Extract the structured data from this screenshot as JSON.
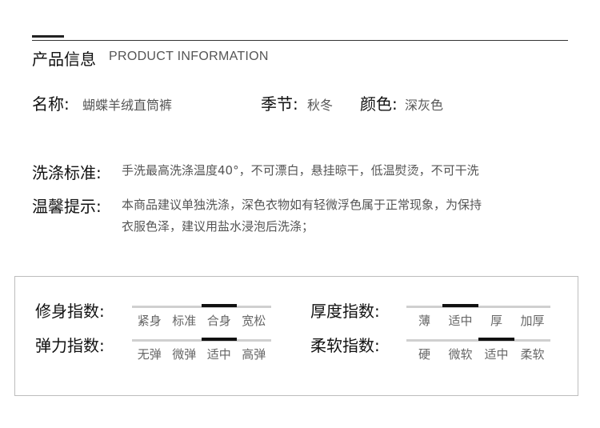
{
  "header": {
    "title_cn": "产品信息",
    "title_en": "PRODUCT INFORMATION"
  },
  "info": {
    "name_label": "名称:",
    "name_value": "蝴蝶羊绒直筒裤",
    "season_label": "季节:",
    "season_value": "秋冬",
    "color_label": "颜色:",
    "color_value": "深灰色"
  },
  "care": {
    "wash_label": "洗涤标准:",
    "wash_value": "手洗最高洗涤温度40°，不可漂白，悬挂晾干，低温熨烫，不可干洗",
    "tips_label": "温馨提示:",
    "tips_line1": "本商品建议单独洗涤，深色衣物如有轻微浮色属于正常现象，为保持",
    "tips_line2": "衣服色泽，建议用盐水浸泡后洗涤；"
  },
  "indices": {
    "fit": {
      "label": "修身指数:",
      "options": [
        "紧身",
        "标准",
        "合身",
        "宽松"
      ],
      "selected": 2
    },
    "thickness": {
      "label": "厚度指数:",
      "options": [
        "薄",
        "适中",
        "厚",
        "加厚"
      ],
      "selected": 1
    },
    "elasticity": {
      "label": "弹力指数:",
      "options": [
        "无弹",
        "微弹",
        "适中",
        "高弹"
      ],
      "selected": 2
    },
    "softness": {
      "label": "柔软指数:",
      "options": [
        "硬",
        "微软",
        "适中",
        "柔软"
      ],
      "selected": 2
    }
  }
}
